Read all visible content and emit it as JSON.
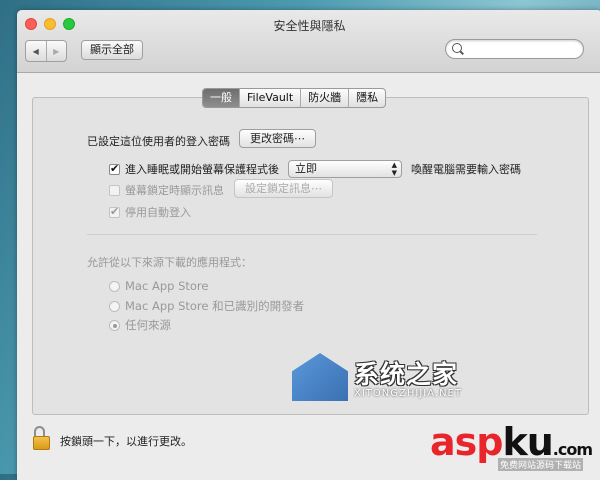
{
  "window": {
    "title": "安全性與隱私",
    "show_all": "顯示全部"
  },
  "tabs": [
    {
      "label": "一般",
      "active": true
    },
    {
      "label": "FileVault",
      "active": false
    },
    {
      "label": "防火牆",
      "active": false
    },
    {
      "label": "隱私",
      "active": false
    }
  ],
  "general": {
    "password_label": "已設定這位使用者的登入密碼",
    "change_password_button": "更改密碼⋯",
    "require_password_label": "進入睡眠或開始螢幕保護程式後",
    "require_password_checked": true,
    "require_password_delay": "立即",
    "require_password_suffix": "喚醒電腦需要輸入密碼",
    "show_message_label": "螢幕鎖定時顯示訊息",
    "show_message_checked": false,
    "set_lock_message_button": "設定鎖定訊息⋯",
    "disable_autologin_label": "停用自動登入",
    "disable_autologin_checked": true
  },
  "download_section": {
    "heading": "允許從以下來源下載的應用程式：",
    "options": [
      {
        "label": "Mac App Store",
        "selected": false
      },
      {
        "label": "Mac App Store 和已識別的開發者",
        "selected": false
      },
      {
        "label": "任何來源",
        "selected": true
      }
    ]
  },
  "footer": {
    "lock_text": "按鎖頭一下，以進行更改。"
  },
  "watermarks": {
    "xitong_cn": "系统之家",
    "xitong_en": "XITONGZHIJIA.NET",
    "aspku_red": "asp",
    "aspku_black": "ku",
    "aspku_tld": ".com",
    "aspku_sub": "免费网站源码下载站"
  },
  "colors": {
    "active_tab": "#7a7a7a",
    "lock_gold": "#e0a526",
    "aspku_red": "#e8252b"
  }
}
